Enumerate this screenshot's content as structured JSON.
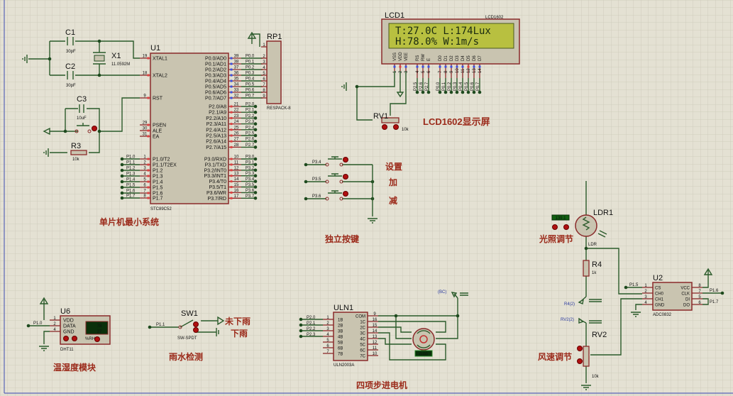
{
  "colors": {
    "wire": "#2a5a2a",
    "component_outline": "#8a2a2a",
    "component_fill": "#c9c4b0",
    "label": "#9b2a1a",
    "lcd_screen": "#b8c040",
    "background": "#e4e1d3"
  },
  "u1": {
    "ref": "U1",
    "part": "STC89C52",
    "left_pins": [
      {
        "num": "19",
        "name": "XTAL1"
      },
      {
        "num": "18",
        "name": "XTAL2"
      },
      {
        "num": "9",
        "name": "RST"
      },
      {
        "num": "29",
        "name": "PSEN"
      },
      {
        "num": "30",
        "name": "ALE"
      },
      {
        "num": "31",
        "name": "EA"
      },
      {
        "num": "1",
        "name": "P1.0/T2"
      },
      {
        "num": "2",
        "name": "P1.1/T2EX"
      },
      {
        "num": "3",
        "name": "P1.2"
      },
      {
        "num": "4",
        "name": "P1.3"
      },
      {
        "num": "5",
        "name": "P1.4"
      },
      {
        "num": "6",
        "name": "P1.5"
      },
      {
        "num": "7",
        "name": "P1.6"
      },
      {
        "num": "8",
        "name": "P1.7"
      }
    ],
    "p1_nets": [
      "P1.0",
      "P1.1",
      "P1.2",
      "P1.3",
      "P1.4",
      "P1.5",
      "P1.6",
      "P1.7"
    ],
    "right_pins": [
      {
        "num": "39",
        "name": "P0.0/AD0",
        "net": "P0.0"
      },
      {
        "num": "38",
        "name": "P0.1/AD1",
        "net": "P0.1"
      },
      {
        "num": "37",
        "name": "P0.2/AD2",
        "net": "P0.2"
      },
      {
        "num": "36",
        "name": "P0.3/AD3",
        "net": "P0.3"
      },
      {
        "num": "35",
        "name": "P0.4/AD4",
        "net": "P0.4"
      },
      {
        "num": "34",
        "name": "P0.5/AD5",
        "net": "P0.5"
      },
      {
        "num": "33",
        "name": "P0.6/AD6",
        "net": "P0.6"
      },
      {
        "num": "32",
        "name": "P0.7/AD7",
        "net": "P0.7"
      },
      {
        "num": "21",
        "name": "P2.0/A8",
        "net": "P2.0"
      },
      {
        "num": "22",
        "name": "P2.1/A9",
        "net": "P2.1"
      },
      {
        "num": "23",
        "name": "P2.2/A10",
        "net": "P2.2"
      },
      {
        "num": "24",
        "name": "P2.3/A11",
        "net": "P2.3"
      },
      {
        "num": "25",
        "name": "P2.4/A12",
        "net": "P2.4"
      },
      {
        "num": "26",
        "name": "P2.5/A13",
        "net": "P2.5"
      },
      {
        "num": "27",
        "name": "P2.6/A14",
        "net": "P2.6"
      },
      {
        "num": "28",
        "name": "P2.7/A15",
        "net": "P2.7"
      },
      {
        "num": "10",
        "name": "P3.0/RXD",
        "net": "P3.0"
      },
      {
        "num": "11",
        "name": "P3.1/TXD",
        "net": "P3.1"
      },
      {
        "num": "12",
        "name": "P3.2/INT0",
        "net": "P3.2"
      },
      {
        "num": "13",
        "name": "P3.3/INT1",
        "net": "P3.3"
      },
      {
        "num": "14",
        "name": "P3.4/T0",
        "net": "P3.4"
      },
      {
        "num": "15",
        "name": "P3.5/T1",
        "net": "P3.5"
      },
      {
        "num": "16",
        "name": "P3.6/WR",
        "net": "P3.6"
      },
      {
        "num": "17",
        "name": "P3.7/RD",
        "net": "P3.7"
      }
    ]
  },
  "rp1": {
    "ref": "RP1",
    "part": "RESPACK-8",
    "pins": [
      "1",
      "2",
      "3",
      "4",
      "5",
      "6",
      "7",
      "8",
      "9"
    ]
  },
  "c1": {
    "ref": "C1",
    "value": "30pF"
  },
  "c2": {
    "ref": "C2",
    "value": "30pF"
  },
  "x1": {
    "ref": "X1",
    "value": "11.0592M"
  },
  "c3": {
    "ref": "C3",
    "value": "10uF"
  },
  "r3": {
    "ref": "R3",
    "value": "10k"
  },
  "lcd": {
    "ref": "LCD1",
    "part": "LCD1602",
    "line1": "T:27.0C L:174Lux",
    "line2": "H:78.0% W:1m/s",
    "pins": [
      {
        "num": "1",
        "name": "VSS"
      },
      {
        "num": "2",
        "name": "VDD"
      },
      {
        "num": "3",
        "name": "VEE"
      },
      {
        "num": "4",
        "name": "RS",
        "net": "P2.5"
      },
      {
        "num": "5",
        "name": "RW",
        "net": "P2.6"
      },
      {
        "num": "6",
        "name": "E",
        "net": "P2.7"
      },
      {
        "num": "7",
        "name": "D0",
        "net": "P0.0"
      },
      {
        "num": "8",
        "name": "D1",
        "net": "P0.1"
      },
      {
        "num": "9",
        "name": "D2",
        "net": "P0.2"
      },
      {
        "num": "10",
        "name": "D3",
        "net": "P0.3"
      },
      {
        "num": "11",
        "name": "D4",
        "net": "P0.4"
      },
      {
        "num": "12",
        "name": "D5",
        "net": "P0.5"
      },
      {
        "num": "13",
        "name": "D6",
        "net": "P0.6"
      },
      {
        "num": "14",
        "name": "D7",
        "net": "P0.7"
      }
    ]
  },
  "rv1": {
    "ref": "RV1",
    "value": "10k"
  },
  "buttons": {
    "nets": [
      "P3.4",
      "P3.5",
      "P3.6"
    ],
    "labels": [
      "设置",
      "加",
      "减"
    ]
  },
  "ldr": {
    "ref": "LDR1",
    "part": "LDR",
    "readout": "139.1"
  },
  "r4": {
    "ref": "R4",
    "value": "1k",
    "probe": "R4(2)"
  },
  "rv2": {
    "ref": "RV2",
    "value": "10k",
    "probe": "RV2(2)"
  },
  "u2": {
    "ref": "U2",
    "part": "ADC0832",
    "left": [
      {
        "num": "1",
        "name": "CS",
        "net": "P1.5"
      },
      {
        "num": "2",
        "name": "CH0"
      },
      {
        "num": "3",
        "name": "CH1"
      },
      {
        "num": "4",
        "name": "GND"
      }
    ],
    "right": [
      {
        "num": "8",
        "name": "VCC"
      },
      {
        "num": "7",
        "name": "CLK",
        "net": "P1.6"
      },
      {
        "num": "5",
        "name": "DI",
        "net": "P1.7"
      },
      {
        "num": "6",
        "name": "DO"
      }
    ]
  },
  "u6": {
    "ref": "U6",
    "part": "DHT11",
    "pins": [
      {
        "num": "1",
        "name": "VDD"
      },
      {
        "num": "2",
        "name": "DATA"
      },
      {
        "num": "4",
        "name": "GND"
      }
    ],
    "net": "P1.0",
    "humidity": "78",
    "temperature": "27",
    "unit": "%RH"
  },
  "sw1": {
    "ref": "SW1",
    "part": "SW-SPDT",
    "net": "P1.1",
    "no_rain": "未下雨",
    "rain": "下雨"
  },
  "uln": {
    "ref": "ULN1",
    "part": "ULN2003A",
    "left": [
      {
        "num": "1",
        "name": "1B",
        "net": "P2.0"
      },
      {
        "num": "2",
        "name": "2B",
        "net": "P2.1"
      },
      {
        "num": "3",
        "name": "3B",
        "net": "P2.2"
      },
      {
        "num": "4",
        "name": "4B",
        "net": "P2.3"
      },
      {
        "num": "5",
        "name": "5B"
      },
      {
        "num": "6",
        "name": "6B"
      },
      {
        "num": "7",
        "name": "7B"
      }
    ],
    "right": [
      {
        "num": "9",
        "name": "COM"
      },
      {
        "num": "16",
        "name": "1C"
      },
      {
        "num": "15",
        "name": "2C"
      },
      {
        "num": "14",
        "name": "3C"
      },
      {
        "num": "13",
        "name": "4C"
      },
      {
        "num": "12",
        "name": "5C"
      },
      {
        "num": "11",
        "name": "6C"
      },
      {
        "num": "10",
        "name": "7C"
      }
    ],
    "motor_readout": "0.00",
    "probe": "(BC)"
  },
  "section_labels": {
    "mcu": "单片机最小系统",
    "lcd": "LCD1602显示屏",
    "keys": "独立按键",
    "light": "光照调节",
    "wind": "风速调节",
    "dht": "温湿度模块",
    "rain": "雨水检测",
    "motor": "四项步进电机"
  }
}
